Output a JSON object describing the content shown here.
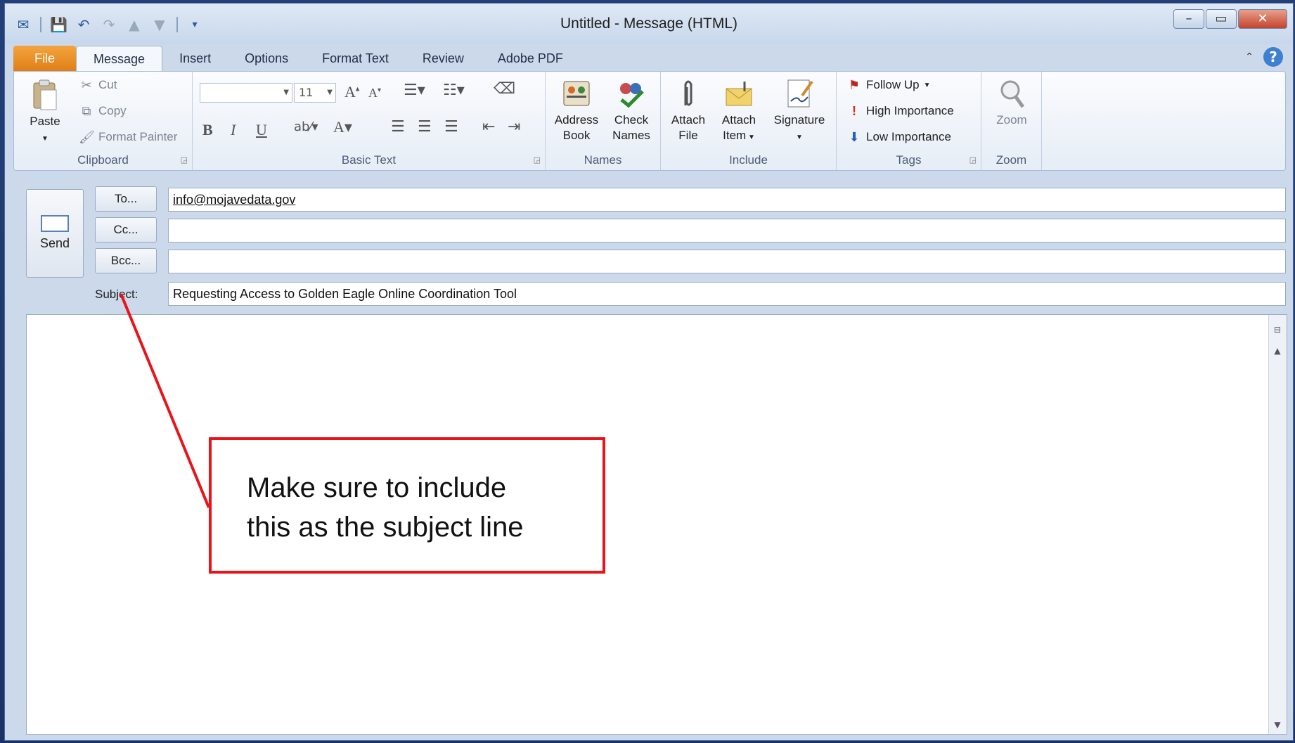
{
  "window": {
    "title": "Untitled  -  Message (HTML)",
    "minimize": "–",
    "maximize": "▭",
    "close": "✕"
  },
  "tabs": [
    {
      "label": "File"
    },
    {
      "label": "Message"
    },
    {
      "label": "Insert"
    },
    {
      "label": "Options"
    },
    {
      "label": "Format Text"
    },
    {
      "label": "Review"
    },
    {
      "label": "Adobe PDF"
    }
  ],
  "help_label": "?",
  "ribbon": {
    "clipboard": {
      "group_label": "Clipboard",
      "paste": "Paste",
      "cut": "Cut",
      "copy": "Copy",
      "format_painter": "Format Painter"
    },
    "basic_text": {
      "group_label": "Basic Text",
      "font_size": "11",
      "bold": "B",
      "italic": "I",
      "underline": "U"
    },
    "names": {
      "group_label": "Names",
      "address_book_1": "Address",
      "address_book_2": "Book",
      "check_names_1": "Check",
      "check_names_2": "Names"
    },
    "include": {
      "group_label": "Include",
      "attach_file_1": "Attach",
      "attach_file_2": "File",
      "attach_item_1": "Attach",
      "attach_item_2": "Item",
      "signature": "Signature"
    },
    "tags": {
      "group_label": "Tags",
      "follow_up": "Follow Up",
      "high_importance": "High Importance",
      "low_importance": "Low Importance"
    },
    "zoom": {
      "group_label": "Zoom",
      "zoom": "Zoom"
    }
  },
  "compose": {
    "send": "Send",
    "to_button": "To...",
    "cc_button": "Cc...",
    "bcc_button": "Bcc...",
    "to_value": "info@mojavedata.gov",
    "cc_value": "",
    "bcc_value": "",
    "subject_label": "Subject:",
    "subject_value": "Requesting Access to Golden Eagle Online Coordination Tool"
  },
  "callout": {
    "line1": "Make sure to include",
    "line2": "this as the subject line"
  },
  "colors": {
    "accent_red": "#e8141a",
    "file_tab": "#e98a1f",
    "window_frame": "#ccd9ea"
  }
}
